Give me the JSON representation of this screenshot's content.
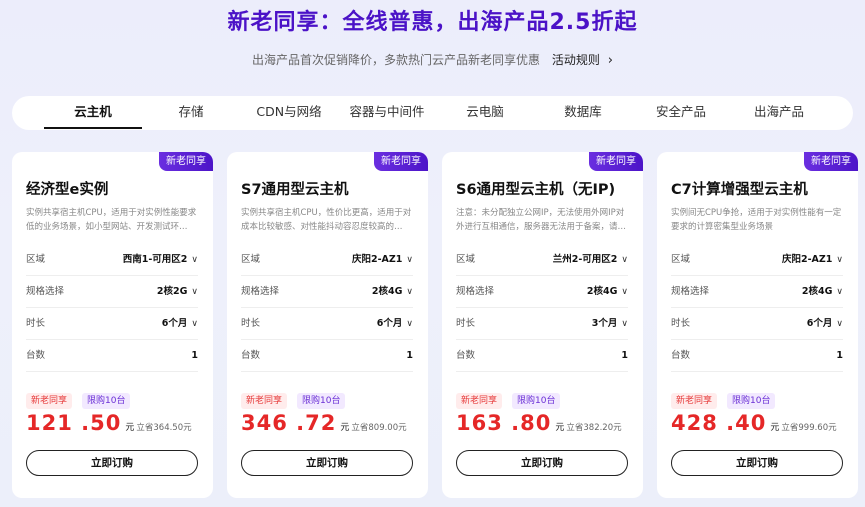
{
  "header": {
    "title": "新老同享：全线普惠，出海产品2.5折起",
    "subtitle": "出海产品首次促销降价，多款热门云产品新老同享优惠",
    "rules_link": "活动规则",
    "rules_chevron": "›"
  },
  "tabs": [
    {
      "label": "云主机",
      "active": true
    },
    {
      "label": "存储"
    },
    {
      "label": "CDN与网络"
    },
    {
      "label": "容器与中间件"
    },
    {
      "label": "云电脑"
    },
    {
      "label": "数据库"
    },
    {
      "label": "安全产品"
    },
    {
      "label": "出海产品"
    }
  ],
  "labels": {
    "region": "区域",
    "spec": "规格选择",
    "duration": "时长",
    "count": "台数",
    "tag_new": "新老同享",
    "tag_limit": "限购10台",
    "unit": "元",
    "buy": "立即订购",
    "dropdown": "∨"
  },
  "cards": [
    {
      "badge": "新老同享",
      "title": "经济型e实例",
      "desc": "实例共享宿主机CPU，适用于对实例性能要求低的业务场景，如小型网站、开发测试环…",
      "region": "西南1-可用区2",
      "spec": "2核2G",
      "duration": "6个月",
      "count": "1",
      "price": "121 .50",
      "save": "立省364.50元"
    },
    {
      "badge": "新老同享",
      "title": "S7通用型云主机",
      "desc": "实例共享宿主机CPU，性价比更高，适用于对成本比较敏感、对性能抖动容忍度较高的…",
      "region": "庆阳2-AZ1",
      "spec": "2核4G",
      "duration": "6个月",
      "count": "1",
      "price": "346 .72",
      "save": "立省809.00元"
    },
    {
      "badge": "新老同享",
      "title": "S6通用型云主机（无IP)",
      "desc": "注意：未分配独立公网IP，无法使用外网IP对外进行互相通信，服务器无法用于备案，请…",
      "region": "兰州2-可用区2",
      "spec": "2核4G",
      "duration": "3个月",
      "count": "1",
      "price": "163 .80",
      "save": "立省382.20元"
    },
    {
      "badge": "新老同享",
      "title": "C7计算增强型云主机",
      "desc": "实例间无CPU争抢，适用于对实例性能有一定要求的计算密集型业务场景",
      "region": "庆阳2-AZ1",
      "spec": "2核4G",
      "duration": "6个月",
      "count": "1",
      "price": "428 .40",
      "save": "立省999.60元"
    }
  ]
}
